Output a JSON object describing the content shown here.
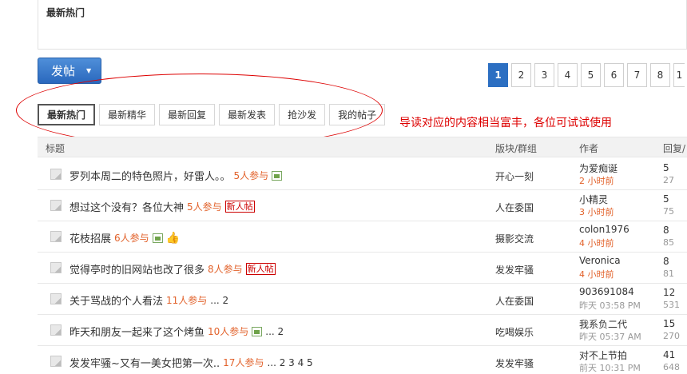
{
  "top_panel": {
    "title": "最新热门"
  },
  "post_button": {
    "label": "发帖",
    "caret": "▼"
  },
  "pager": {
    "pages": [
      "1",
      "2",
      "3",
      "4",
      "5",
      "6",
      "7",
      "8",
      "1"
    ],
    "current": "1"
  },
  "tabs": [
    "最新热门",
    "最新精华",
    "最新回复",
    "最新发表",
    "抢沙发",
    "我的帖子"
  ],
  "annotation": "导读对应的内容相当富丰，各位可试试使用",
  "table_header": {
    "title": "标题",
    "forum": "版块/群组",
    "author": "作者",
    "reply": "回复/"
  },
  "rows": [
    {
      "title": "罗列本周二的特色照片，好雷人。。",
      "count": "5人参与",
      "img": true,
      "new": false,
      "thumb": false,
      "pages": "",
      "forum": "开心一刻",
      "author": "为爱痴诞",
      "time": "2 小时前",
      "time_recent": true,
      "replies": "5",
      "views": "27"
    },
    {
      "title": "想过这个没有？各位大神",
      "count": "5人参与",
      "img": false,
      "new": true,
      "thumb": false,
      "pages": "",
      "forum": "人在委国",
      "author": "小精灵",
      "time": "3 小时前",
      "time_recent": true,
      "replies": "5",
      "views": "75"
    },
    {
      "title": "花枝招展",
      "count": "6人参与",
      "img": true,
      "new": false,
      "thumb": true,
      "pages": "",
      "forum": "摄影交流",
      "author": "colon1976",
      "time": "4 小时前",
      "time_recent": true,
      "replies": "8",
      "views": "85"
    },
    {
      "title": "觉得亭时的旧网站也改了很多",
      "count": "8人参与",
      "img": false,
      "new": true,
      "thumb": false,
      "pages": "",
      "forum": "发发牢骚",
      "author": "Veronica",
      "time": "4 小时前",
      "time_recent": true,
      "replies": "8",
      "views": "81"
    },
    {
      "title": "关于骂战的个人看法",
      "count": "11人参与",
      "img": false,
      "new": false,
      "thumb": false,
      "pages": "... 2",
      "forum": "人在委国",
      "author": "903691084",
      "time": "昨天 03:58 PM",
      "time_recent": false,
      "replies": "12",
      "views": "531"
    },
    {
      "title": "昨天和朋友一起来了这个烤鱼",
      "count": "10人参与",
      "img": true,
      "new": false,
      "thumb": false,
      "pages": "... 2",
      "forum": "吃喝娱乐",
      "author": "我系负二代",
      "time": "昨天 05:37 AM",
      "time_recent": false,
      "replies": "15",
      "views": "270"
    },
    {
      "title": "发发牢骚~又有一美女把第一次..",
      "count": "17人参与",
      "img": false,
      "new": false,
      "thumb": false,
      "pages": "... 2 3 4 5",
      "forum": "发发牢骚",
      "author": "对不上节拍",
      "time": "前天 10:31 PM",
      "time_recent": false,
      "replies": "41",
      "views": "648"
    }
  ],
  "labels": {
    "new_badge": "新人帖",
    "thumb": "👍"
  }
}
